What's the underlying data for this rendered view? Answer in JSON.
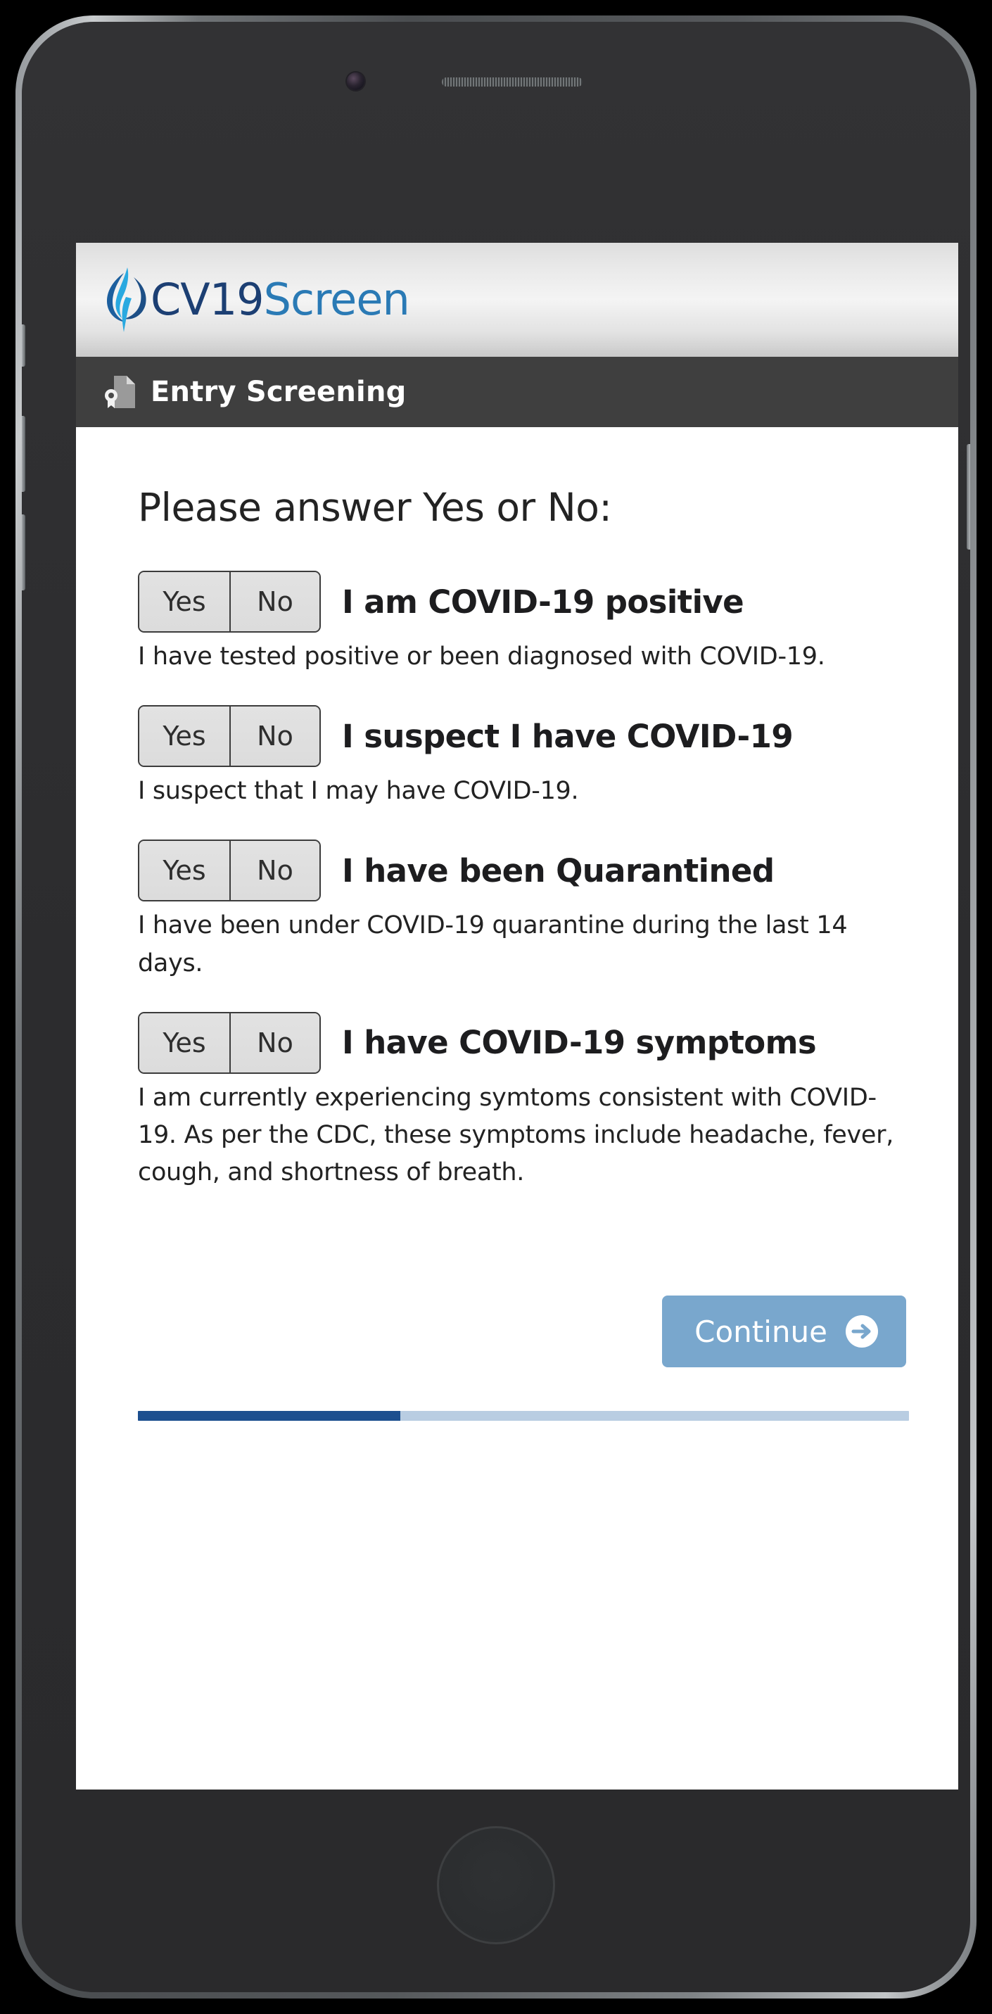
{
  "device": {
    "camera_icon": "camera-icon",
    "speaker_icon": "earpiece-speaker",
    "home_button": "home-button"
  },
  "app": {
    "logo_icon": "cv19-flame-logo-icon",
    "logo_primary": "CV19",
    "logo_secondary": "Screen",
    "logo_primary_color": "#1c3f73",
    "logo_secondary_color": "#2a7ab5"
  },
  "title_bar": {
    "icon": "screening-document-icon",
    "title": "Entry Screening",
    "background_color": "#3f3f3f"
  },
  "main": {
    "heading": "Please answer Yes or No:",
    "options": {
      "yes": "Yes",
      "no": "No"
    },
    "questions": [
      {
        "title": "I am COVID-19 positive",
        "description": "I have tested positive or been diagnosed with COVID-19."
      },
      {
        "title": "I suspect I have COVID-19",
        "description": "I suspect that I may have COVID-19."
      },
      {
        "title": "I have been Quarantined",
        "description": "I have been under COVID-19 quarantine during the last 14 days."
      },
      {
        "title": "I have COVID-19 symptoms",
        "description": "I am currently experiencing symtoms consistent with COVID-19. As per the CDC, these symptoms include headache, fever, cough, and shortness of breath."
      }
    ]
  },
  "footer": {
    "continue_label": "Continue",
    "continue_icon": "arrow-right-circle-icon",
    "continue_color": "#79a7cd",
    "progress_percent": 34,
    "progress_fill_color": "#1c4f8f",
    "progress_track_color": "#b9cde2"
  }
}
